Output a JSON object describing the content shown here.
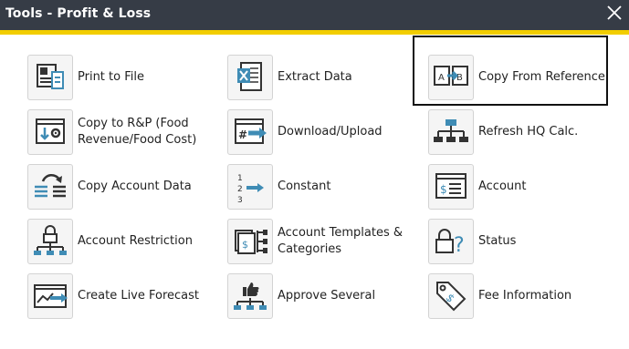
{
  "window": {
    "title": "Tools - Profit & Loss",
    "close_label": "Close",
    "accent_color": "#f2cd00",
    "titlebar_color": "#363c46",
    "icon_color": "#3f8cb5"
  },
  "tools": [
    {
      "label": "Print to File",
      "icon": "print-to-file-icon"
    },
    {
      "label": "Extract Data",
      "icon": "excel-extract-icon"
    },
    {
      "label": "Copy From Reference",
      "icon": "copy-a-to-b-icon",
      "selected": true
    },
    {
      "label": "Copy to R&P (Food Revenue/Food Cost)",
      "icon": "download-settings-icon"
    },
    {
      "label": "Download/Upload",
      "icon": "hash-arrow-icon"
    },
    {
      "label": "Refresh HQ Calc.",
      "icon": "hierarchy-icon"
    },
    {
      "label": "Copy Account Data",
      "icon": "rotate-copy-icon"
    },
    {
      "label": "Constant",
      "icon": "numbered-arrow-icon"
    },
    {
      "label": "Account",
      "icon": "account-window-icon"
    },
    {
      "label": "Account Restriction",
      "icon": "lock-hierarchy-icon"
    },
    {
      "label": "Account Templates & Categories",
      "icon": "templates-icon"
    },
    {
      "label": "Status",
      "icon": "lock-question-icon"
    },
    {
      "label": "Create Live Forecast",
      "icon": "forecast-chart-icon"
    },
    {
      "label": "Approve Several",
      "icon": "thumbs-up-hierarchy-icon"
    },
    {
      "label": "Fee Information",
      "icon": "price-tag-icon"
    }
  ]
}
